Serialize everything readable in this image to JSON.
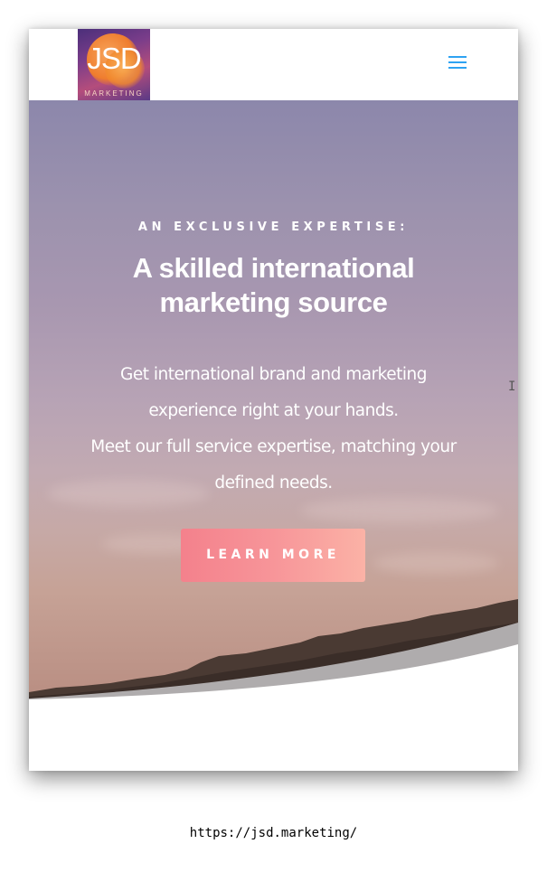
{
  "header": {
    "logo_text": "JSD",
    "logo_subtext": "MARKETING",
    "menu_icon": "hamburger-menu-icon"
  },
  "hero": {
    "eyebrow": "AN EXCLUSIVE EXPERTISE:",
    "headline": "A skilled international marketing source",
    "body_lines": [
      "Get international brand and marketing",
      "experience right at your hands.",
      "Meet our full service expertise, matching your",
      "defined needs."
    ],
    "cta_label": "LEARN MORE"
  },
  "colors": {
    "accent": "#2ea3f2",
    "cta_start": "#f4818c",
    "cta_end": "#fbb2a6"
  },
  "footer_caption": {
    "url": "https://jsd.marketing/"
  }
}
